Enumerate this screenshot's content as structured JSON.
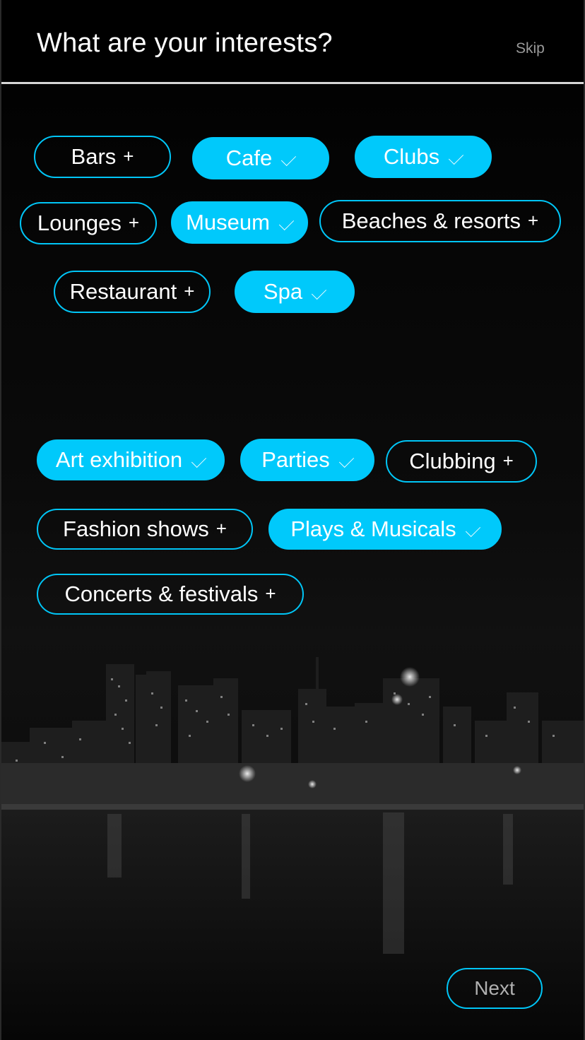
{
  "header": {
    "title": "What are your interests?",
    "skip_label": "Skip"
  },
  "places": [
    {
      "label": "Bars",
      "selected": false
    },
    {
      "label": "Cafe",
      "selected": true
    },
    {
      "label": "Clubs",
      "selected": true
    },
    {
      "label": "Lounges",
      "selected": false
    },
    {
      "label": "Museum",
      "selected": true
    },
    {
      "label": "Beaches & resorts",
      "selected": false
    },
    {
      "label": "Restaurant",
      "selected": false
    },
    {
      "label": "Spa",
      "selected": true
    }
  ],
  "events": [
    {
      "label": "Art exhibition",
      "selected": true
    },
    {
      "label": "Parties",
      "selected": true
    },
    {
      "label": "Clubbing",
      "selected": false
    },
    {
      "label": "Fashion shows",
      "selected": false
    },
    {
      "label": "Plays & Musicals",
      "selected": true
    },
    {
      "label": "Concerts & festivals",
      "selected": false
    }
  ],
  "footer": {
    "next_label": "Next"
  },
  "icons": {
    "plus": "plus-icon",
    "check": "check-icon"
  },
  "colors": {
    "accent": "#00c9fb",
    "background": "#000000",
    "divider": "#d6d6d6"
  }
}
